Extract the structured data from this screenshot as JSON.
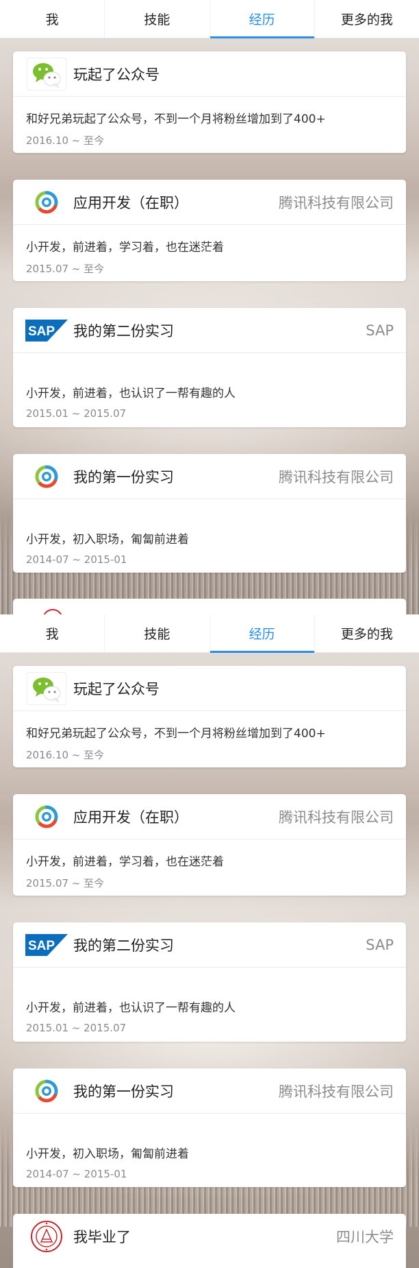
{
  "tabs": [
    {
      "label": "我"
    },
    {
      "label": "技能"
    },
    {
      "label": "经历",
      "active": true
    },
    {
      "label": "更多的我"
    }
  ],
  "cards": [
    {
      "icon": "wechat-icon",
      "title": "玩起了公众号",
      "org": "",
      "desc": "和好兄弟玩起了公众号，不到一个月将粉丝增加到了400+",
      "date": "2016.10 ~ 至今"
    },
    {
      "icon": "tencent-logo-icon",
      "title": "应用开发（在职）",
      "org": "腾讯科技有限公司",
      "desc": "小开发，前进着，学习着，也在迷茫着",
      "date": "2015.07 ~ 至今"
    },
    {
      "icon": "sap-logo-icon",
      "title": "我的第二份实习",
      "org": "SAP",
      "desc": "小开发，前进着，也认识了一帮有趣的人",
      "date": "2015.01 ~ 2015.07"
    },
    {
      "icon": "tencent-logo-icon",
      "title": "我的第一份实习",
      "org": "腾讯科技有限公司",
      "desc": "小开发，初入职场，匍匐前进着",
      "date": "2014-07 ~ 2015-01"
    },
    {
      "icon": "sichuan-university-logo-icon",
      "title": "我毕业了",
      "org": "四川大学",
      "desc": "",
      "date": ""
    }
  ],
  "colors": {
    "accent": "#2b8fe6",
    "wechat_green": "#7bbf2f",
    "sap_blue": "#0a6ebd",
    "scu_red": "#c8272d"
  }
}
